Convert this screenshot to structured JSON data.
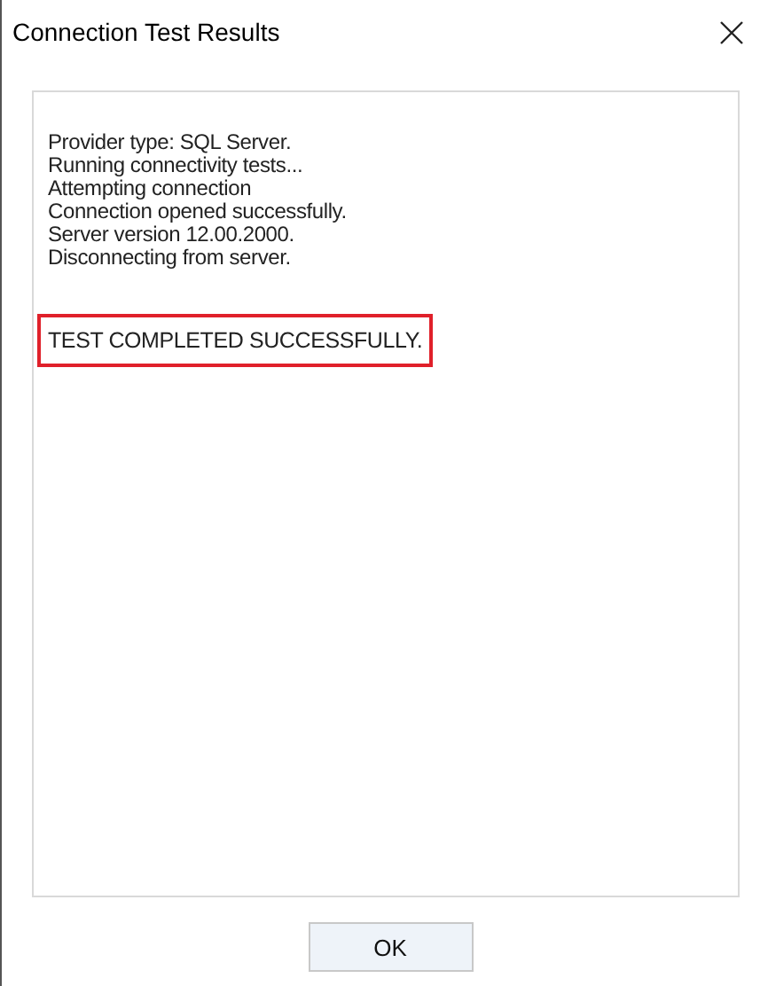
{
  "window": {
    "title": "Connection Test Results"
  },
  "log_lines": [
    "Provider type: SQL Server.",
    "Running connectivity tests...",
    "Attempting connection",
    "Connection opened successfully.",
    "Server version 12.00.2000.",
    "Disconnecting from server."
  ],
  "result_message": "TEST COMPLETED SUCCESSFULLY.",
  "buttons": [
    "OK"
  ]
}
